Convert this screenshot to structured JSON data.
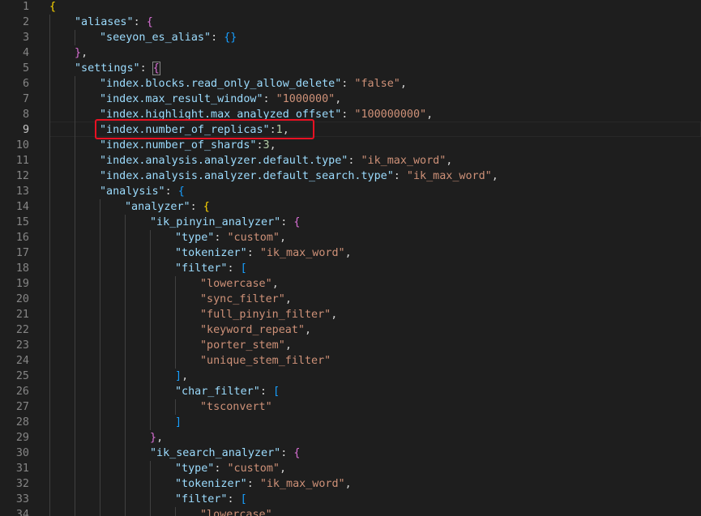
{
  "editor": {
    "lines": [
      {
        "n": "1",
        "indent": 0,
        "t": [
          [
            "b1",
            "{"
          ]
        ]
      },
      {
        "n": "2",
        "indent": 1,
        "t": [
          [
            "key",
            "\"aliases\""
          ],
          [
            "p",
            ": "
          ],
          [
            "b2",
            "{"
          ]
        ]
      },
      {
        "n": "3",
        "indent": 2,
        "t": [
          [
            "key",
            "\"seeyon_es_alias\""
          ],
          [
            "p",
            ": "
          ],
          [
            "b3",
            "{}"
          ]
        ]
      },
      {
        "n": "4",
        "indent": 1,
        "t": [
          [
            "b2",
            "}"
          ],
          [
            "p",
            ","
          ]
        ]
      },
      {
        "n": "5",
        "indent": 1,
        "t": [
          [
            "key",
            "\"settings\""
          ],
          [
            "p",
            ": "
          ],
          [
            "b2",
            "{"
          ]
        ]
      },
      {
        "n": "6",
        "indent": 2,
        "t": [
          [
            "key",
            "\"index.blocks.read_only_allow_delete\""
          ],
          [
            "p",
            ": "
          ],
          [
            "str",
            "\"false\""
          ],
          [
            "p",
            ","
          ]
        ]
      },
      {
        "n": "7",
        "indent": 2,
        "t": [
          [
            "key",
            "\"index.max_result_window\""
          ],
          [
            "p",
            ": "
          ],
          [
            "str",
            "\"1000000\""
          ],
          [
            "p",
            ","
          ]
        ]
      },
      {
        "n": "8",
        "indent": 2,
        "t": [
          [
            "key",
            "\"index.highlight.max_analyzed_offset\""
          ],
          [
            "p",
            ": "
          ],
          [
            "str",
            "\"100000000\""
          ],
          [
            "p",
            ","
          ]
        ]
      },
      {
        "n": "9",
        "indent": 2,
        "t": [
          [
            "key",
            "\"index.number_of_replicas\""
          ],
          [
            "p",
            ":"
          ],
          [
            "num",
            "1"
          ],
          [
            "p",
            ","
          ]
        ]
      },
      {
        "n": "10",
        "indent": 2,
        "t": [
          [
            "key",
            "\"index.number_of_shards\""
          ],
          [
            "p",
            ":"
          ],
          [
            "num",
            "3"
          ],
          [
            "p",
            ","
          ]
        ]
      },
      {
        "n": "11",
        "indent": 2,
        "t": [
          [
            "key",
            "\"index.analysis.analyzer.default.type\""
          ],
          [
            "p",
            ": "
          ],
          [
            "str",
            "\"ik_max_word\""
          ],
          [
            "p",
            ","
          ]
        ]
      },
      {
        "n": "12",
        "indent": 2,
        "t": [
          [
            "key",
            "\"index.analysis.analyzer.default_search.type\""
          ],
          [
            "p",
            ": "
          ],
          [
            "str",
            "\"ik_max_word\""
          ],
          [
            "p",
            ","
          ]
        ]
      },
      {
        "n": "13",
        "indent": 2,
        "t": [
          [
            "key",
            "\"analysis\""
          ],
          [
            "p",
            ": "
          ],
          [
            "b3",
            "{"
          ]
        ]
      },
      {
        "n": "14",
        "indent": 3,
        "t": [
          [
            "key",
            "\"analyzer\""
          ],
          [
            "p",
            ": "
          ],
          [
            "b1",
            "{"
          ]
        ]
      },
      {
        "n": "15",
        "indent": 4,
        "t": [
          [
            "key",
            "\"ik_pinyin_analyzer\""
          ],
          [
            "p",
            ": "
          ],
          [
            "b2",
            "{"
          ]
        ]
      },
      {
        "n": "16",
        "indent": 5,
        "t": [
          [
            "key",
            "\"type\""
          ],
          [
            "p",
            ": "
          ],
          [
            "str",
            "\"custom\""
          ],
          [
            "p",
            ","
          ]
        ]
      },
      {
        "n": "17",
        "indent": 5,
        "t": [
          [
            "key",
            "\"tokenizer\""
          ],
          [
            "p",
            ": "
          ],
          [
            "str",
            "\"ik_max_word\""
          ],
          [
            "p",
            ","
          ]
        ]
      },
      {
        "n": "18",
        "indent": 5,
        "t": [
          [
            "key",
            "\"filter\""
          ],
          [
            "p",
            ": "
          ],
          [
            "b3",
            "["
          ]
        ]
      },
      {
        "n": "19",
        "indent": 6,
        "t": [
          [
            "str",
            "\"lowercase\""
          ],
          [
            "p",
            ","
          ]
        ]
      },
      {
        "n": "20",
        "indent": 6,
        "t": [
          [
            "str",
            "\"sync_filter\""
          ],
          [
            "p",
            ","
          ]
        ]
      },
      {
        "n": "21",
        "indent": 6,
        "t": [
          [
            "str",
            "\"full_pinyin_filter\""
          ],
          [
            "p",
            ","
          ]
        ]
      },
      {
        "n": "22",
        "indent": 6,
        "t": [
          [
            "str",
            "\"keyword_repeat\""
          ],
          [
            "p",
            ","
          ]
        ]
      },
      {
        "n": "23",
        "indent": 6,
        "t": [
          [
            "str",
            "\"porter_stem\""
          ],
          [
            "p",
            ","
          ]
        ]
      },
      {
        "n": "24",
        "indent": 6,
        "t": [
          [
            "str",
            "\"unique_stem_filter\""
          ]
        ]
      },
      {
        "n": "25",
        "indent": 5,
        "t": [
          [
            "b3",
            "]"
          ],
          [
            "p",
            ","
          ]
        ]
      },
      {
        "n": "26",
        "indent": 5,
        "t": [
          [
            "key",
            "\"char_filter\""
          ],
          [
            "p",
            ": "
          ],
          [
            "b3",
            "["
          ]
        ]
      },
      {
        "n": "27",
        "indent": 6,
        "t": [
          [
            "str",
            "\"tsconvert\""
          ]
        ]
      },
      {
        "n": "28",
        "indent": 5,
        "t": [
          [
            "b3",
            "]"
          ]
        ]
      },
      {
        "n": "29",
        "indent": 4,
        "t": [
          [
            "b2",
            "}"
          ],
          [
            "p",
            ","
          ]
        ]
      },
      {
        "n": "30",
        "indent": 4,
        "t": [
          [
            "key",
            "\"ik_search_analyzer\""
          ],
          [
            "p",
            ": "
          ],
          [
            "b2",
            "{"
          ]
        ]
      },
      {
        "n": "31",
        "indent": 5,
        "t": [
          [
            "key",
            "\"type\""
          ],
          [
            "p",
            ": "
          ],
          [
            "str",
            "\"custom\""
          ],
          [
            "p",
            ","
          ]
        ]
      },
      {
        "n": "32",
        "indent": 5,
        "t": [
          [
            "key",
            "\"tokenizer\""
          ],
          [
            "p",
            ": "
          ],
          [
            "str",
            "\"ik_max_word\""
          ],
          [
            "p",
            ","
          ]
        ]
      },
      {
        "n": "33",
        "indent": 5,
        "t": [
          [
            "key",
            "\"filter\""
          ],
          [
            "p",
            ": "
          ],
          [
            "b3",
            "["
          ]
        ]
      },
      {
        "n": "34",
        "indent": 6,
        "t": [
          [
            "str",
            "\"lowercase\""
          ],
          [
            "p",
            ","
          ]
        ]
      }
    ],
    "colors": {
      "background": "#1e1e1e",
      "key": "#9cdcfe",
      "string": "#ce9178",
      "number": "#b5cea8",
      "punctuation": "#d4d4d4",
      "highlight_box": "#e81123"
    }
  }
}
